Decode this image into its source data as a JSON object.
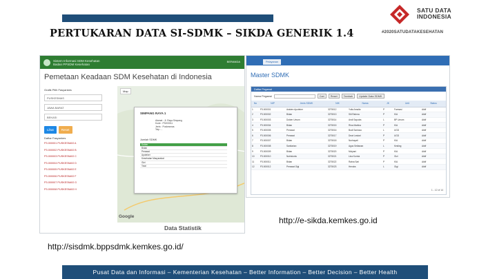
{
  "slide": {
    "title": "PERTUKARAN DATA SI-SDMK – SIKDA GENERIK 1.4",
    "hashtag": "#2020SATUDATAKESEHATAN",
    "logo_text": [
      "SATU DATA",
      "INDONESIA"
    ],
    "url_right": "http://e-sikda.kemkes.go.id",
    "url_left": "http://sisdmk.bppsdmk.kemkes.go.id/",
    "footer": "Pusat Data dan Informasi – Kementerian Kesehatan – Better Information – Better Decision – Better Health",
    "colors": {
      "bar": "#1f4e79",
      "logo_red": "#c62828"
    }
  },
  "left_app": {
    "header_title": [
      "Sistem Informasi SDM Kesehatan",
      "Badan PPSDM Kesehatan"
    ],
    "header_nav": "BERANDA",
    "page_title": "Pemetaan Keadaan SDM Kesehatan di Indonesia",
    "filter_label": "Grafik Pilih Fasyankes",
    "selects": [
      "PUSKESMAS",
      "JAWA BARAT",
      "BEKASI"
    ],
    "btn_view": "Lihat",
    "btn_reset": "Reset",
    "list_title": "Daftar Fasyankes",
    "list_items": [
      "P3.000001 PUSKESMAS A",
      "P3.000002 PUSKESMAS B",
      "P3.000003 PUSKESMAS C",
      "P3.000004 PUSKESMAS D",
      "P3.000005 PUSKESMAS E",
      "P3.000006 PUSKESMAS F",
      "P3.000007 PUSKESMAS G",
      "P3.000008 PUSKESMAS H"
    ],
    "map_toolbar": "Map",
    "popup_title": "SIMPANG RAYA 1",
    "popup_lines": [
      "Alamat : Jl. Raya Simpang",
      "Kode : P3203011",
      "Jenis : Puskesmas",
      "Telp : -"
    ],
    "popup_subtitle": "Jumlah SDMK",
    "popup_rows": [
      "Dokter",
      "Bidan",
      "Perawat",
      "Apoteker",
      "Kesehatan Masyarakat",
      "Gizi",
      "Total"
    ],
    "google": "Google",
    "footer_title": "Data Statistik",
    "colors": {
      "header": "#2e7d32",
      "highlight": "#43a047"
    }
  },
  "right_app": {
    "tab": "Pelayanan",
    "title": "Master SDMK",
    "panel_title": "Daftar Pegawai",
    "search_label": "Nama Pegawai",
    "buttons": [
      "Cari",
      "Reset",
      "Tambah",
      "Update Data SDMK"
    ],
    "columns": [
      "No",
      "NIP",
      "Jenis SDMK",
      "NIK",
      "Nama",
      "JK",
      "Unit",
      "Status"
    ],
    "rows": [
      [
        "1",
        "P3.000001",
        "Asisten Apoteker",
        "3275012",
        "Yulia Amalia",
        "P",
        "Farmasi",
        "Aktif"
      ],
      [
        "2",
        "P3.000002",
        "Bidan",
        "3275013",
        "Siti Rahma",
        "P",
        "KIA",
        "Aktif"
      ],
      [
        "3",
        "P3.000003",
        "Dokter Umum",
        "3275014",
        "Andi Saputra",
        "L",
        "BP Umum",
        "Aktif"
      ],
      [
        "4",
        "P3.000004",
        "Bidan",
        "3275015",
        "Rina Marlina",
        "P",
        "KIA",
        "Aktif"
      ],
      [
        "5",
        "P3.000005",
        "Perawat",
        "3275016",
        "Budi Santoso",
        "L",
        "UGD",
        "Aktif"
      ],
      [
        "6",
        "P3.000006",
        "Perawat",
        "3275017",
        "Dewi Lestari",
        "P",
        "UGD",
        "Aktif"
      ],
      [
        "7",
        "P3.000007",
        "Bidan",
        "3275018",
        "Nurhayati",
        "P",
        "KIA",
        "Aktif"
      ],
      [
        "8",
        "P3.000008",
        "Sanitarian",
        "3275019",
        "Agus Setiawan",
        "L",
        "Kesling",
        "Aktif"
      ],
      [
        "9",
        "P3.000009",
        "Bidan",
        "3275020",
        "Mulyani",
        "P",
        "KIA",
        "Aktif"
      ],
      [
        "10",
        "P3.000010",
        "Nutrisionis",
        "3275021",
        "Lina Kurnia",
        "P",
        "Gizi",
        "Aktif"
      ],
      [
        "11",
        "P3.000011",
        "Bidan",
        "3275022",
        "Ratna Sari",
        "P",
        "KIA",
        "Aktif"
      ],
      [
        "12",
        "P3.000012",
        "Perawat Gigi",
        "3275023",
        "Hendra",
        "L",
        "Gigi",
        "Aktif"
      ]
    ],
    "pager": "1 - 12 of 14",
    "colors": {
      "header": "#2f6db5"
    }
  }
}
